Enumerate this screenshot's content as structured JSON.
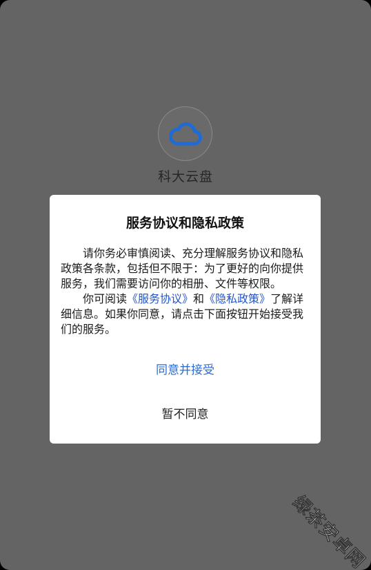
{
  "app": {
    "name": "科大云盘",
    "logo_icon": "cloud-icon",
    "logo_color": "#1f6bd6"
  },
  "dialog": {
    "title": "服务协议和隐私政策",
    "paragraph1": "请你务必审慎阅读、充分理解服务协议和隐私政策各条款，包括但不限于：为了更好的向你提供服务，我们需要访问你的相册、文件等权限。",
    "paragraph2_prefix": "你可阅读",
    "service_agreement_link": "《服务协议》",
    "and_text": "和",
    "privacy_policy_link": "《隐私政策》",
    "paragraph2_suffix": "了解详细信息。如果你同意，请点击下面按钮开始接受我们的服务。",
    "agree_label": "同意并接受",
    "decline_label": "暂不同意"
  },
  "watermark": {
    "text": "绿茶安卓网"
  },
  "colors": {
    "overlay": "#646464",
    "link": "#2255cc",
    "agree": "#2a6bd1"
  }
}
